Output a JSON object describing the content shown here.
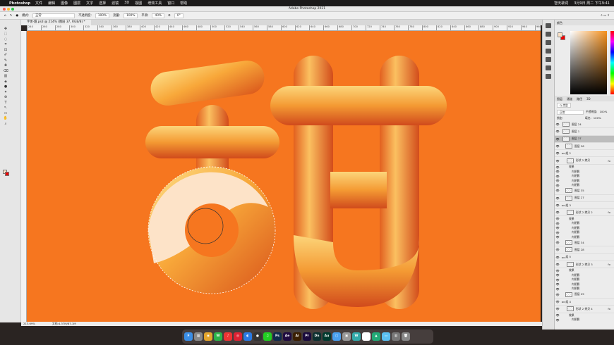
{
  "menubar": {
    "apple": "",
    "app": "Photoshop",
    "items": [
      "文件",
      "编辑",
      "图像",
      "图层",
      "文字",
      "选择",
      "滤镜",
      "3D",
      "视图",
      "增效工具",
      "窗口",
      "帮助"
    ],
    "status_text": "智天歌词",
    "clock": "3月9日 周二 下午9:41"
  },
  "window": {
    "title": "Adobe Photoshop 2021"
  },
  "options": {
    "mode_label": "模式:",
    "mode": "正常",
    "opacity_label": "不透明度:",
    "opacity": "100%",
    "flow_label": "流量:",
    "flow": "100%",
    "smooth_label": "平滑:",
    "smooth": "40%",
    "angle": "0°"
  },
  "tab": {
    "label": "字体-甜.psd @ 214% (图层 37, RGB/8) *"
  },
  "ruler": {
    "ticks": [
      "240",
      "260",
      "280",
      "300",
      "320",
      "340",
      "360",
      "380",
      "400",
      "420",
      "440",
      "460",
      "480",
      "500",
      "520",
      "540",
      "560",
      "580",
      "600",
      "620",
      "640",
      "660",
      "680",
      "700",
      "720",
      "740",
      "760",
      "780",
      "800",
      "820",
      "840",
      "860",
      "880",
      "900",
      "920",
      "940",
      "960",
      "980",
      "1000",
      "1020",
      "1040",
      "1060",
      "1080",
      "1100",
      "1120",
      "1140",
      "1160",
      "1180",
      "1200",
      "1220"
    ]
  },
  "status": {
    "zoom": "213.69%",
    "doc": "文档:4.37M/87.1M"
  },
  "panel": {
    "color_tab": "颜色",
    "layer_tabs": [
      "图层",
      "通道",
      "路径",
      "3D"
    ],
    "filter": "Q 类型",
    "blend": "正常",
    "opacity_label": "不透明度:",
    "opacity": "100%",
    "lock_label": "锁定:",
    "fill_label": "填充:",
    "fill": "100%",
    "layers": [
      {
        "name": "图层 24",
        "kind": "layer"
      },
      {
        "name": "图层 1",
        "kind": "layer"
      },
      {
        "name": "图层 37",
        "kind": "layer",
        "selected": true
      },
      {
        "name": "图层 26",
        "kind": "clip"
      },
      {
        "name": "组 2",
        "kind": "group"
      },
      {
        "name": "形状 2 拷贝",
        "kind": "shape",
        "fx": "fx"
      },
      {
        "name": "效果",
        "kind": "effects"
      },
      {
        "name": "内阴影",
        "kind": "effect"
      },
      {
        "name": "内阴影",
        "kind": "effect"
      },
      {
        "name": "内阴影",
        "kind": "effect"
      },
      {
        "name": "内阴影",
        "kind": "effect"
      },
      {
        "name": "图层 35",
        "kind": "clip"
      },
      {
        "name": "图层 27",
        "kind": "clip"
      },
      {
        "name": "组 3",
        "kind": "group"
      },
      {
        "name": "形状 2 拷贝 2",
        "kind": "shape",
        "fx": "fx"
      },
      {
        "name": "效果",
        "kind": "effects"
      },
      {
        "name": "内阴影",
        "kind": "effect"
      },
      {
        "name": "内阴影",
        "kind": "effect"
      },
      {
        "name": "内阴影",
        "kind": "effect"
      },
      {
        "name": "内阴影",
        "kind": "effect"
      },
      {
        "name": "图层 34",
        "kind": "clip"
      },
      {
        "name": "图层 28",
        "kind": "clip"
      },
      {
        "name": "组 5",
        "kind": "group"
      },
      {
        "name": "形状 2 拷贝 3",
        "kind": "shape",
        "fx": "fx"
      },
      {
        "name": "效果",
        "kind": "effects"
      },
      {
        "name": "内阴影",
        "kind": "effect"
      },
      {
        "name": "内阴影",
        "kind": "effect"
      },
      {
        "name": "内阴影",
        "kind": "effect"
      },
      {
        "name": "内阴影",
        "kind": "effect"
      },
      {
        "name": "图层 29",
        "kind": "clip"
      },
      {
        "name": "组 4",
        "kind": "group"
      },
      {
        "name": "形状 2 拷贝 4",
        "kind": "shape",
        "fx": "fx"
      },
      {
        "name": "效果",
        "kind": "effects"
      },
      {
        "name": "内阴影",
        "kind": "effect"
      }
    ]
  },
  "dock": [
    {
      "l": "F",
      "c": "#3a8ee6"
    },
    {
      "l": "▦",
      "c": "#888"
    },
    {
      "l": "◉",
      "c": "#e5a52b"
    },
    {
      "l": "W",
      "c": "#2bb34a"
    },
    {
      "l": "♪",
      "c": "#e33"
    },
    {
      "l": "◎",
      "c": "#d23"
    },
    {
      "l": "◐",
      "c": "#2a7ae4"
    },
    {
      "l": "●",
      "c": "#333"
    },
    {
      "l": "♫",
      "c": "#2c2"
    },
    {
      "l": "Ps",
      "c": "#0f2a4d"
    },
    {
      "l": "Ae",
      "c": "#1f0a40"
    },
    {
      "l": "Ai",
      "c": "#3a1e00"
    },
    {
      "l": "Pr",
      "c": "#1a0a3d"
    },
    {
      "l": "Dn",
      "c": "#0b3030"
    },
    {
      "l": "Au",
      "c": "#003a2e"
    },
    {
      "l": "▢",
      "c": "#4aa0ee"
    },
    {
      "l": "▣",
      "c": "#999"
    },
    {
      "l": "W",
      "c": "#3aa"
    },
    {
      "l": "◔",
      "c": "#fff"
    },
    {
      "l": "▲",
      "c": "#2a7"
    },
    {
      "l": "▭",
      "c": "#5bc0f0"
    },
    {
      "l": "▥",
      "c": "#777"
    },
    {
      "l": "🗑",
      "c": "#888"
    }
  ],
  "colors": {
    "canvas": "#f6761f",
    "foreground": "#fbe2c6",
    "background": "#e00000"
  }
}
